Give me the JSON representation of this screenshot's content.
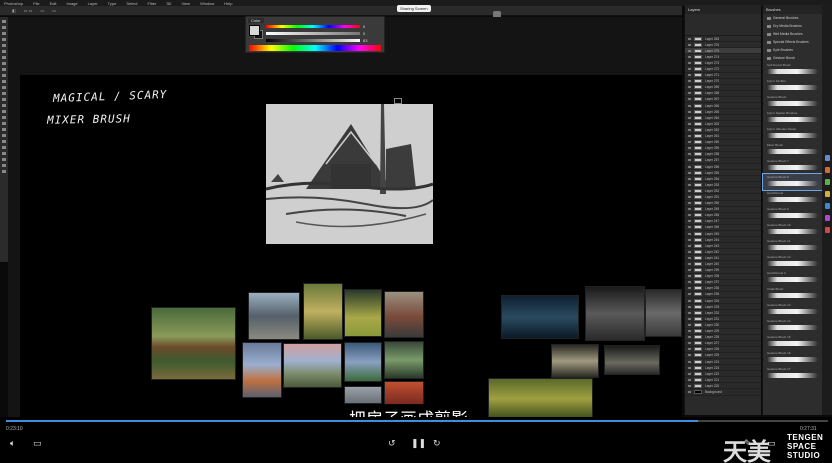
{
  "menubar": [
    "Photoshop",
    "File",
    "Edit",
    "Image",
    "Layer",
    "Type",
    "Select",
    "Filter",
    "3D",
    "View",
    "Window",
    "Help"
  ],
  "sharing_label": "Sharing Screen",
  "canvas": {
    "handwriting_line1": "MAGICAL / SCARY",
    "handwriting_line2": "MIXER BRUSH"
  },
  "color_panel": {
    "tab": "Color",
    "values": [
      "0",
      "0",
      "83"
    ]
  },
  "layers_panel": {
    "title": "Layers",
    "rows": [
      "Layer 283",
      "Layer 276",
      "Layer 275",
      "Layer 274",
      "Layer 273",
      "Layer 272",
      "Layer 271",
      "Layer 270",
      "Layer 269",
      "Layer 268",
      "Layer 267",
      "Layer 266",
      "Layer 265",
      "Layer 264",
      "Layer 263",
      "Layer 262",
      "Layer 261",
      "Layer 260",
      "Layer 259",
      "Layer 258",
      "Layer 257",
      "Layer 256",
      "Layer 255",
      "Layer 254",
      "Layer 253",
      "Layer 252",
      "Layer 251",
      "Layer 250",
      "Layer 249",
      "Layer 248",
      "Layer 247",
      "Layer 246",
      "Layer 245",
      "Layer 244",
      "Layer 243",
      "Layer 242",
      "Layer 241",
      "Layer 240",
      "Layer 239",
      "Layer 238",
      "Layer 237",
      "Layer 236",
      "Layer 235",
      "Layer 234",
      "Layer 233",
      "Layer 232",
      "Layer 231",
      "Layer 230",
      "Layer 229",
      "Layer 228",
      "Layer 227",
      "Layer 226",
      "Layer 225",
      "Layer 224",
      "Layer 223",
      "Layer 222",
      "Layer 221",
      "Layer 220",
      "Background"
    ]
  },
  "brushes_panel": {
    "title": "Brushes",
    "folders": [
      "General Brushes",
      "Dry Media Brushes",
      "Wet Media Brushes",
      "Special Effects Brushes",
      "Kyle Brushes",
      "Gesture Brush"
    ],
    "items": [
      "Soft Round Brush",
      "Kyle's Ink Box",
      "Gesture Brush",
      "Kyle's Spatter Brushes",
      "Kyle's Ultimate Pastel",
      "Mixer Brush",
      "Gesture Brush 7",
      "Gesture Brush 8",
      "Hard Round",
      "Gesture Brush 9",
      "Gesture Brush 10",
      "Gesture Brush 11",
      "Gesture Brush 12",
      "Hard Round 2",
      "Chalk Brush",
      "Gesture Brush 13",
      "Gesture Brush 14",
      "Gesture Brush 15",
      "Gesture Brush 16",
      "Gesture Brush 17"
    ],
    "selected_index": 7
  },
  "subtitle": "把房子画成剪影",
  "player": {
    "current_time": "0:23:10",
    "total_time": "0:27:31",
    "progress": 0.842
  },
  "logo": {
    "cn": "天美",
    "line1": "TENGEN",
    "line2": "SPACE",
    "line3": "STUDIO"
  },
  "colors": {
    "accent": "#3e8ee0",
    "canvas_bg": "#000000",
    "sketch_bg": "#cfcfcf"
  }
}
